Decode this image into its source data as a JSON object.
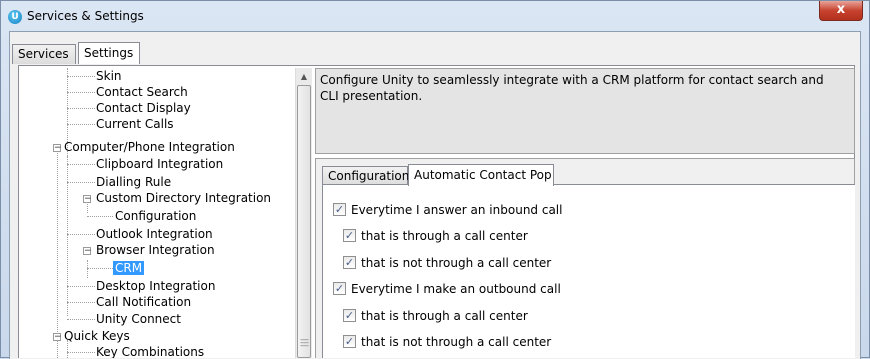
{
  "window": {
    "title": "Services & Settings",
    "app_icon_letter": "U",
    "close_label": "x"
  },
  "main_tabs": [
    {
      "label": "Services",
      "active": false
    },
    {
      "label": "Settings",
      "active": true
    }
  ],
  "tree": {
    "items": [
      {
        "label": "Skin"
      },
      {
        "label": "Contact Search"
      },
      {
        "label": "Contact Display"
      },
      {
        "label": "Current Calls"
      },
      {
        "label": "Computer/Phone Integration",
        "expanded": true
      },
      {
        "label": "Clipboard Integration"
      },
      {
        "label": "Dialling Rule"
      },
      {
        "label": "Custom Directory Integration",
        "expanded": true
      },
      {
        "label": "Configuration"
      },
      {
        "label": "Outlook Integration"
      },
      {
        "label": "Browser Integration",
        "expanded": true
      },
      {
        "label": "CRM",
        "selected": true
      },
      {
        "label": "Desktop Integration"
      },
      {
        "label": "Call Notification"
      },
      {
        "label": "Unity Connect"
      },
      {
        "label": "Quick Keys",
        "expanded": true
      },
      {
        "label": "Key Combinations"
      }
    ]
  },
  "description": "Configure Unity to seamlessly integrate with a CRM platform for contact search and CLI presentation.",
  "inner_tabs": [
    {
      "label": "Configuration",
      "active": false
    },
    {
      "label": "Automatic Contact Pop",
      "active": true
    }
  ],
  "options": [
    {
      "label": "Everytime I answer an inbound call",
      "checked": true
    },
    {
      "label": "that is through a call center",
      "checked": true
    },
    {
      "label": "that is not through a call center",
      "checked": true
    },
    {
      "label": "Everytime I make an outbound call",
      "checked": true
    },
    {
      "label": "that is through a call center",
      "checked": true
    },
    {
      "label": "that is not through a call center",
      "checked": true
    }
  ],
  "check_glyph": "✓"
}
